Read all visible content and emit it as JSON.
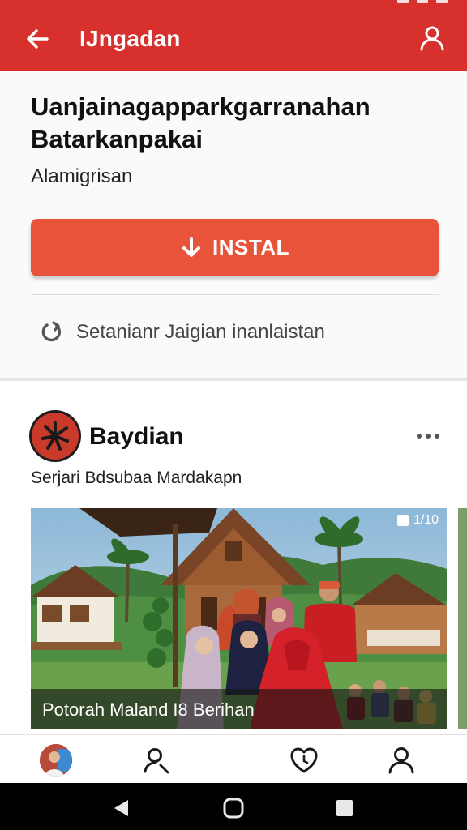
{
  "app_bar": {
    "title": "IJngadan",
    "back_icon": "arrow-left-icon",
    "profile_icon": "person-icon",
    "color": "#d8302d"
  },
  "app_info": {
    "title": "Uanjainagaрparkgarranahan Batarkanpakai",
    "subtitle": "Alamigrisan",
    "install_label": "INSTAL",
    "install_icon": "download-arrow-icon",
    "install_color": "#e8543a",
    "update_label": "Setanianr Jaigian inanlaistan",
    "update_icon": "refresh-icon"
  },
  "post": {
    "author": "Baydian",
    "caption": "Serjari Bdsubaa Mardakapn",
    "media_counter": "1/10",
    "media_caption": "Potorah Maland I8 Berihan",
    "more_icon": "more-horizontal-icon"
  },
  "bottom_nav": {
    "items": [
      {
        "icon": "user-avatar-icon"
      },
      {
        "icon": "person-search-icon"
      },
      {
        "icon": "heart-clock-icon"
      },
      {
        "icon": "person-icon"
      }
    ]
  },
  "system_nav": {
    "back_icon": "back-triangle-icon",
    "home_icon": "home-circle-icon",
    "recents_icon": "recents-square-icon"
  }
}
